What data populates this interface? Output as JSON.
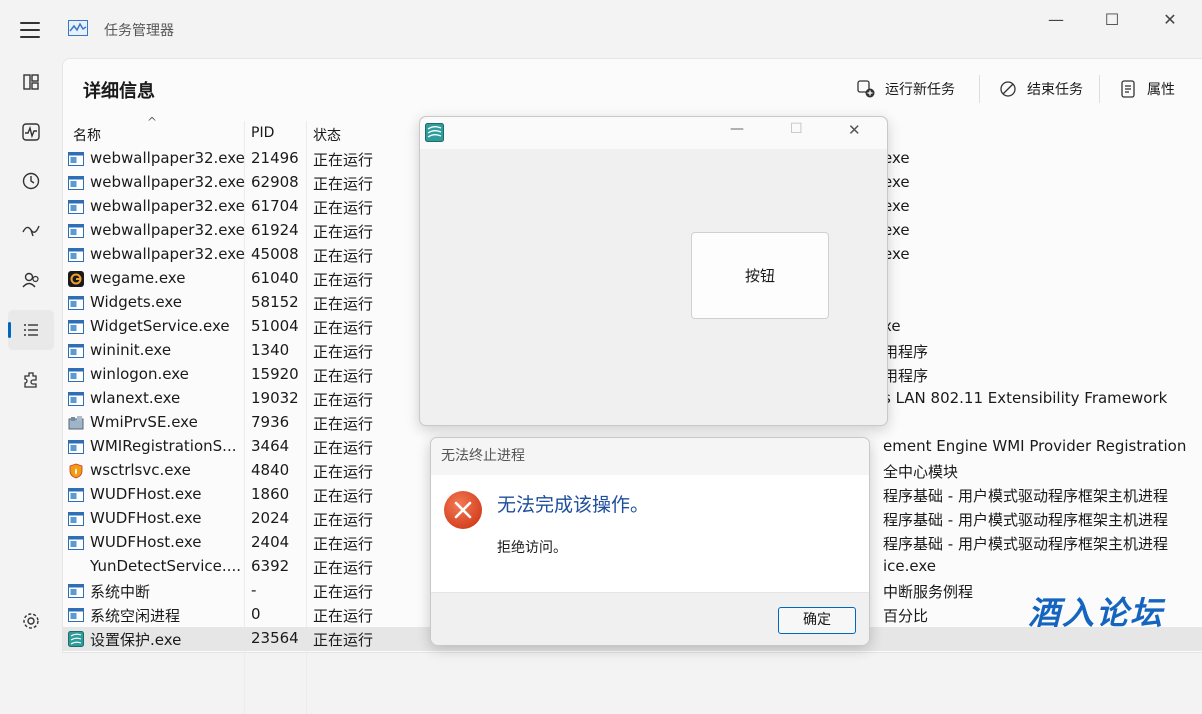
{
  "window": {
    "title": "任务管理器",
    "minimize": "—",
    "maximize": "☐",
    "close": "✕"
  },
  "nav": {
    "items": [
      {
        "icon": "processes-icon"
      },
      {
        "icon": "performance-icon"
      },
      {
        "icon": "app-history-icon"
      },
      {
        "icon": "startup-apps-icon"
      },
      {
        "icon": "users-icon"
      },
      {
        "icon": "details-icon",
        "active": true
      },
      {
        "icon": "services-icon"
      }
    ],
    "settings_icon": "settings-icon"
  },
  "header": {
    "title": "详细信息",
    "run_new_task": "运行新任务",
    "end_task": "结束任务",
    "properties": "属性"
  },
  "table": {
    "columns": {
      "name": "名称",
      "pid": "PID",
      "status": "状态",
      "sort_indicator": "^"
    },
    "rows": [
      {
        "name": "webwallpaper32.exe",
        "pid": "21496",
        "status": "正在运行",
        "desc": "exe",
        "icon": "window-icon"
      },
      {
        "name": "webwallpaper32.exe",
        "pid": "62908",
        "status": "正在运行",
        "desc": "exe",
        "icon": "window-icon"
      },
      {
        "name": "webwallpaper32.exe",
        "pid": "61704",
        "status": "正在运行",
        "desc": "exe",
        "icon": "window-icon"
      },
      {
        "name": "webwallpaper32.exe",
        "pid": "61924",
        "status": "正在运行",
        "desc": "exe",
        "icon": "window-icon"
      },
      {
        "name": "webwallpaper32.exe",
        "pid": "45008",
        "status": "正在运行",
        "desc": "exe",
        "icon": "window-icon"
      },
      {
        "name": "wegame.exe",
        "pid": "61040",
        "status": "正在运行",
        "desc": "",
        "icon": "wegame-icon"
      },
      {
        "name": "Widgets.exe",
        "pid": "58152",
        "status": "正在运行",
        "desc": "",
        "icon": "window-icon"
      },
      {
        "name": "WidgetService.exe",
        "pid": "51004",
        "status": "正在运行",
        "desc": "xe",
        "icon": "window-icon"
      },
      {
        "name": "wininit.exe",
        "pid": "1340",
        "status": "正在运行",
        "desc": "用程序",
        "icon": "window-icon"
      },
      {
        "name": "winlogon.exe",
        "pid": "15920",
        "status": "正在运行",
        "desc": "用程序",
        "icon": "window-icon"
      },
      {
        "name": "wlanext.exe",
        "pid": "19032",
        "status": "正在运行",
        "desc": "s LAN 802.11 Extensibility Framework",
        "icon": "window-icon"
      },
      {
        "name": "WmiPrvSE.exe",
        "pid": "7936",
        "status": "正在运行",
        "desc": "",
        "icon": "wmi-icon"
      },
      {
        "name": "WMIRegistrationS...",
        "pid": "3464",
        "status": "正在运行",
        "desc": "ement Engine WMI Provider Registration",
        "icon": "window-icon"
      },
      {
        "name": "wsctrlsvc.exe",
        "pid": "4840",
        "status": "正在运行",
        "desc": "全中心模块",
        "icon": "shield-fire-icon"
      },
      {
        "name": "WUDFHost.exe",
        "pid": "1860",
        "status": "正在运行",
        "desc": "程序基础 - 用户模式驱动程序框架主机进程",
        "icon": "window-icon"
      },
      {
        "name": "WUDFHost.exe",
        "pid": "2024",
        "status": "正在运行",
        "desc": "程序基础 - 用户模式驱动程序框架主机进程",
        "icon": "window-icon"
      },
      {
        "name": "WUDFHost.exe",
        "pid": "2404",
        "status": "正在运行",
        "desc": "程序基础 - 用户模式驱动程序框架主机进程",
        "icon": "window-icon"
      },
      {
        "name": "YunDetectService....",
        "pid": "6392",
        "status": "正在运行",
        "desc": "ice.exe",
        "icon": "blank-icon"
      },
      {
        "name": "系统中断",
        "pid": "-",
        "status": "正在运行",
        "desc": "中断服务例程",
        "icon": "window-icon"
      },
      {
        "name": "系统空闲进程",
        "pid": "0",
        "status": "正在运行",
        "desc": "百分比",
        "icon": "window-icon"
      },
      {
        "name": "设置保护.exe",
        "pid": "23564",
        "status": "正在运行",
        "desc": "",
        "icon": "app-icon",
        "selected": true
      }
    ]
  },
  "dialog_app": {
    "button_label": "按钮",
    "minimize": "—",
    "maximize": "☐",
    "close": "✕"
  },
  "dialog_error": {
    "title": "无法终止进程",
    "main": "无法完成该操作。",
    "sub": "拒绝访问。",
    "ok": "确定"
  },
  "watermark": "酒入论坛",
  "colors": {
    "accent": "#0067c0",
    "error": "#e0482a",
    "heading_blue": "#1e4e9c"
  }
}
